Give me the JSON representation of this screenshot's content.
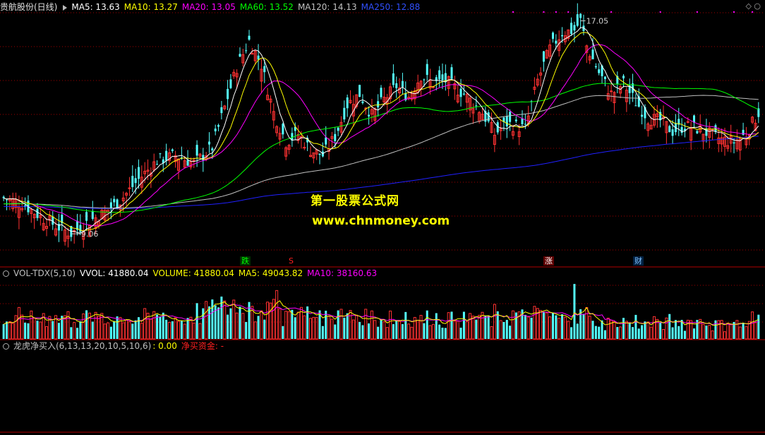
{
  "main_header": {
    "title": "贵航股份(日线)",
    "ma5": "MA5: 13.63",
    "ma10": "MA10: 13.27",
    "ma20": "MA20: 13.05",
    "ma60": "MA60: 13.52",
    "ma120": "MA120: 14.13",
    "ma250": "MA250: 12.88"
  },
  "vol_header": {
    "title": "VOL-TDX(5,10)",
    "vvol": "VVOL: 41880.04",
    "volume": "VOLUME: 41880.04",
    "ma5": "MA5: 49043.82",
    "ma10": "MA10: 38160.63"
  },
  "ind_header": {
    "title": "龙虎净买入(6,13,13,20,10,5,10,6)",
    "value": ": 0.00",
    "label": "净买资金: -"
  },
  "watermark": {
    "line1": "第一股票公式网",
    "line2": "www.chnmoney.com"
  },
  "tags": {
    "die": "跌",
    "s": "S",
    "zhang": "涨",
    "cai": "财"
  },
  "colors": {
    "up": "#ff3232",
    "down": "#54ffff",
    "ma5": "#ffffff",
    "ma10": "#ffff00",
    "ma20": "#ff00ff",
    "ma60": "#00ff00",
    "ma120": "#c0c0c0",
    "ma250": "#2020ff",
    "grid": "#a00000",
    "watermark": "#ffff00"
  },
  "chart_data": {
    "type": "line",
    "high_label": "17.05",
    "low_label": "9.06",
    "ma_current": {
      "MA5": 13.63,
      "MA10": 13.27,
      "MA20": 13.05,
      "MA60": 13.52,
      "MA120": 14.13,
      "MA250": 12.88
    },
    "close_path": [
      [
        0,
        10.4
      ],
      [
        6,
        10.2
      ],
      [
        12,
        9.7
      ],
      [
        18,
        9.3
      ],
      [
        22,
        9.06
      ],
      [
        26,
        9.4
      ],
      [
        32,
        9.8
      ],
      [
        38,
        10.3
      ],
      [
        44,
        11.1
      ],
      [
        50,
        11.8
      ],
      [
        56,
        12.0
      ],
      [
        62,
        11.7
      ],
      [
        68,
        12.3
      ],
      [
        72,
        13.8
      ],
      [
        76,
        15.3
      ],
      [
        80,
        16.3
      ],
      [
        84,
        15.4
      ],
      [
        88,
        13.6
      ],
      [
        92,
        12.5
      ],
      [
        96,
        12.8
      ],
      [
        100,
        12.2
      ],
      [
        104,
        12.0
      ],
      [
        108,
        12.7
      ],
      [
        112,
        13.9
      ],
      [
        116,
        14.3
      ],
      [
        120,
        13.5
      ],
      [
        124,
        14.1
      ],
      [
        128,
        14.6
      ],
      [
        132,
        14.2
      ],
      [
        136,
        15.0
      ],
      [
        140,
        14.7
      ],
      [
        144,
        14.8
      ],
      [
        150,
        14.3
      ],
      [
        156,
        13.6
      ],
      [
        160,
        12.8
      ],
      [
        164,
        13.2
      ],
      [
        170,
        13.0
      ],
      [
        174,
        14.8
      ],
      [
        178,
        16.0
      ],
      [
        182,
        16.6
      ],
      [
        186,
        16.7
      ],
      [
        188,
        17.05
      ],
      [
        190,
        16.1
      ],
      [
        194,
        15.1
      ],
      [
        198,
        14.3
      ],
      [
        202,
        14.7
      ],
      [
        206,
        14.0
      ],
      [
        210,
        13.4
      ],
      [
        214,
        13.3
      ],
      [
        218,
        12.9
      ],
      [
        222,
        13.1
      ],
      [
        226,
        13.0
      ],
      [
        230,
        12.8
      ],
      [
        234,
        12.6
      ],
      [
        238,
        12.5
      ],
      [
        242,
        12.8
      ],
      [
        246,
        13.6
      ]
    ]
  },
  "vol_chart_data": {
    "type": "bar",
    "volume_last": 41880.04,
    "ma5": 49043.82,
    "ma10": 38160.63
  }
}
